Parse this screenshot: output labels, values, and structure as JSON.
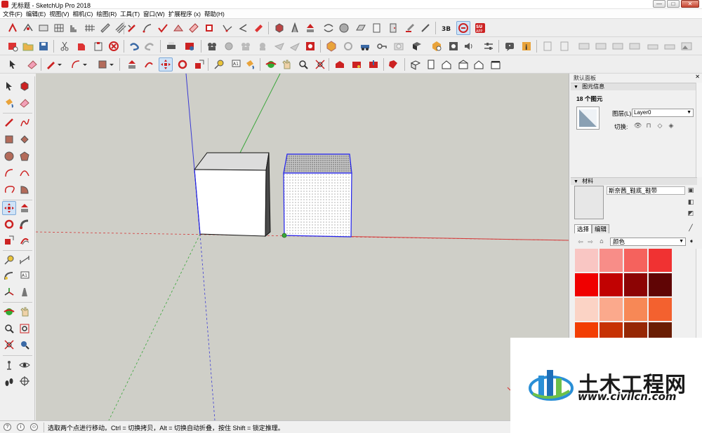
{
  "window": {
    "title": "无标题 - SketchUp Pro 2018",
    "buttons": [
      "—",
      "□",
      "✕"
    ]
  },
  "menu": [
    "文件(F)",
    "编辑(E)",
    "视图(V)",
    "相机(C)",
    "绘图(R)",
    "工具(T)",
    "窗口(W)",
    "扩展程序 (x)",
    "帮助(H)"
  ],
  "tray": {
    "title": "默认面板",
    "close": "✕",
    "entity_info": {
      "header": "图元信息",
      "count": "18 个图元",
      "layer_label": "图层(L):",
      "layer_value": "Layer0",
      "toggle_label": "切换:"
    },
    "materials": {
      "header": "材料",
      "material_name": "斯奈茜_鞋底_鞋带",
      "tab_select": "选择",
      "tab_edit": "编辑",
      "collection": "颜色",
      "swatches": [
        "#f9c6c3",
        "#f88d88",
        "#f5625d",
        "#f03232",
        "#f00000",
        "#c10202",
        "#8c0404",
        "#600505",
        "#fbd3c5",
        "#fba98c",
        "#f78856",
        "#f3612f",
        "#f23e04",
        "#c73204",
        "#962704",
        "#6a1d03"
      ]
    }
  },
  "status": {
    "text": "选取两个点进行移动。Ctrl = 切换拷贝，Alt = 切换自动折叠，按住 Shift = 锁定推理。"
  },
  "watermark": {
    "cn": "土木工程网",
    "url": "www.civilcn.com"
  },
  "colors": {
    "viewport": "#cfcfc8",
    "axis_red": "#d43a3a",
    "axis_green": "#3aa63a",
    "axis_blue": "#3a3ad4",
    "selection_blue": "#2222ee"
  }
}
